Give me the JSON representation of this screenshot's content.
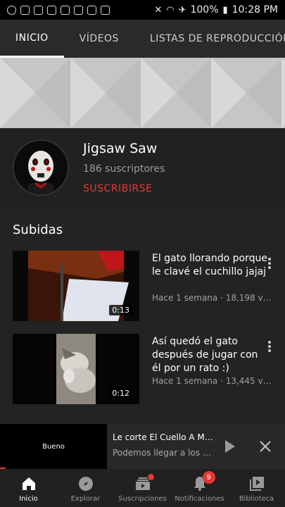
{
  "status_bar": {
    "battery": "100%",
    "time": "10:28 PM"
  },
  "tabs": [
    {
      "label": "INICIO",
      "active": true
    },
    {
      "label": "VÍDEOS",
      "active": false
    },
    {
      "label": "LISTAS DE REPRODUCCIÓN",
      "active": false
    }
  ],
  "channel": {
    "name": "Jigsaw Saw",
    "subscribers": "186 suscriptores",
    "subscribe_label": "SUSCRIBIRSE"
  },
  "uploads": {
    "title": "Subidas",
    "videos": [
      {
        "title": "El gato llorando porque le clavé el cuchillo jajaj",
        "meta": "Hace 1 semana · 18,198 vis…",
        "duration": "0:13"
      },
      {
        "title": "Así quedó el gato después de jugar con él por un rato :)",
        "meta": "Hace 1 semana · 13,445 vis…",
        "duration": "0:12"
      }
    ]
  },
  "miniplayer": {
    "video_text": "Bueno",
    "title": "Le corte El Cuello A M…",
    "subtitle": "Podemos llegar a los …",
    "progress_fraction": 0.02
  },
  "bottom_nav": [
    {
      "label": "Inicio",
      "icon": "home-icon",
      "active": true
    },
    {
      "label": "Explorar",
      "icon": "compass-icon",
      "active": false
    },
    {
      "label": "Suscripciones",
      "icon": "subscriptions-icon",
      "active": false
    },
    {
      "label": "Notificaciones",
      "icon": "bell-icon",
      "active": false,
      "badge": "9"
    },
    {
      "label": "Biblioteca",
      "icon": "library-icon",
      "active": false
    }
  ],
  "colors": {
    "accent": "#e53935",
    "background": "#212121"
  }
}
